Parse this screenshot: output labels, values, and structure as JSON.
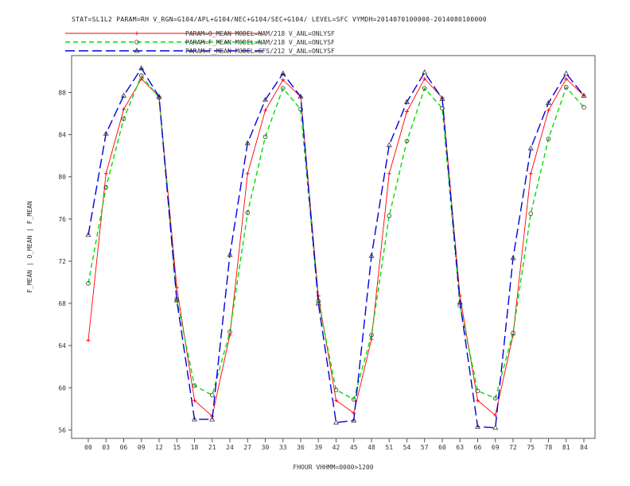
{
  "chart_data": {
    "type": "line",
    "title": "STAT=SL1L2 PARAM=RH V_RGN=G104/APL+G104/NEC+G104/SEC+G104/ LEVEL=SFC VYMDH=2014070100000-2014080100000",
    "xlabel": "FHOUR VHHMM=0000>1200",
    "ylabel": "F_MEAN | O_MEAN | F_MEAN",
    "categories": [
      "00",
      "03",
      "06",
      "09",
      "12",
      "15",
      "18",
      "21",
      "24",
      "27",
      "30",
      "33",
      "36",
      "39",
      "42",
      "45",
      "48",
      "51",
      "54",
      "57",
      "60",
      "63",
      "66",
      "69",
      "72",
      "75",
      "78",
      "81",
      "84"
    ],
    "yticks": [
      "56",
      "60",
      "64",
      "68",
      "72",
      "76",
      "80",
      "84",
      "88"
    ],
    "ylim": [
      55.2,
      91.5
    ],
    "grid": false,
    "legend_position": "top-left",
    "series": [
      {
        "name": "PARAM=O_MEAN MODEL=NAM/218 V_ANL=ONLYSF",
        "color": "#ff0000",
        "dash": "solid",
        "marker": "plus",
        "values": [
          64.5,
          80.3,
          86.4,
          89.3,
          87.6,
          69.5,
          58.8,
          57.3,
          65.0,
          80.3,
          86.3,
          89.2,
          87.6,
          68.7,
          58.8,
          57.6,
          64.6,
          80.3,
          86.2,
          89.3,
          87.5,
          68.7,
          58.8,
          57.4,
          65.0,
          80.3,
          86.3,
          89.3,
          87.7
        ]
      },
      {
        "name": "PARAM=F_MEAN MODEL=NAM/218 V_ANL=ONLYSF",
        "color": "#00dd00",
        "dash": "dashed",
        "marker": "diamond",
        "values": [
          69.9,
          79.0,
          85.5,
          89.6,
          87.5,
          68.4,
          60.2,
          59.3,
          65.3,
          76.6,
          83.8,
          88.4,
          86.4,
          68.2,
          59.8,
          58.9,
          65.0,
          76.3,
          83.4,
          88.4,
          86.5,
          67.8,
          59.7,
          59.0,
          65.2,
          76.5,
          83.6,
          88.5,
          86.6
        ]
      },
      {
        "name": "PARAM=F_MEAN MODEL=GFS/212 V_ANL=ONLYSF",
        "color": "#0000dd",
        "dash": "longdash",
        "marker": "triangle",
        "values": [
          74.5,
          84.1,
          87.7,
          90.3,
          87.6,
          68.3,
          57.0,
          57.0,
          72.6,
          83.2,
          87.3,
          89.8,
          87.6,
          68.0,
          56.7,
          56.9,
          72.5,
          83.0,
          87.1,
          89.9,
          87.4,
          68.1,
          56.3,
          56.2,
          72.3,
          82.7,
          87.0,
          89.8,
          87.7
        ]
      }
    ]
  }
}
